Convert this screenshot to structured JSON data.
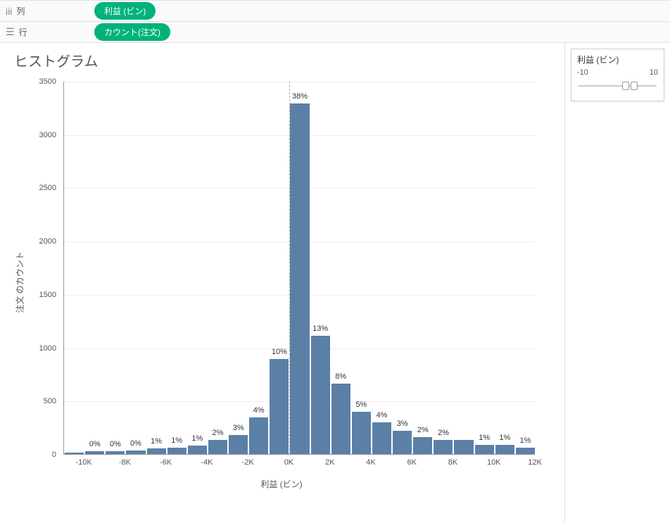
{
  "shelf": {
    "columns_label": "列",
    "rows_label": "行",
    "columns_pill": "利益 (ビン)",
    "rows_pill": "カウント(注文)"
  },
  "filter": {
    "title": "利益 (ビン)",
    "min": "-10",
    "max": "10"
  },
  "chart_title": "ヒストグラム",
  "chart_data": {
    "type": "bar",
    "title": "ヒストグラム",
    "xlabel": "利益 (ビン)",
    "ylabel": "注文 のカウント",
    "ylim": [
      0,
      3500
    ],
    "xlim": [
      -11,
      12
    ],
    "y_ticks": [
      0,
      500,
      1000,
      1500,
      2000,
      2500,
      3000,
      3500
    ],
    "x_ticks": [
      -10,
      -8,
      -6,
      -4,
      -2,
      0,
      2,
      4,
      6,
      8,
      10,
      12
    ],
    "x_tick_labels": [
      "-10K",
      "-8K",
      "-6K",
      "-4K",
      "-2K",
      "0K",
      "2K",
      "4K",
      "6K",
      "8K",
      "10K",
      "12K"
    ],
    "categories": [
      -11,
      -10,
      -9,
      -8,
      -7,
      -6,
      -5,
      -4,
      -3,
      -2,
      -1,
      0,
      1,
      2,
      3,
      4,
      5,
      6,
      7,
      8,
      9,
      10,
      11
    ],
    "values": [
      15,
      25,
      25,
      30,
      50,
      60,
      80,
      130,
      180,
      345,
      890,
      3290,
      1110,
      660,
      395,
      300,
      220,
      160,
      135,
      135,
      85,
      85,
      60,
      60
    ],
    "bar_labels": [
      "",
      "0%",
      "0%",
      "0%",
      "1%",
      "1%",
      "1%",
      "2%",
      "3%",
      "4%",
      "10%",
      "38%",
      "13%",
      "8%",
      "5%",
      "4%",
      "3%",
      "2%",
      "2%",
      "",
      "1%",
      "1%",
      "1%",
      ""
    ],
    "refline_x": 0
  }
}
